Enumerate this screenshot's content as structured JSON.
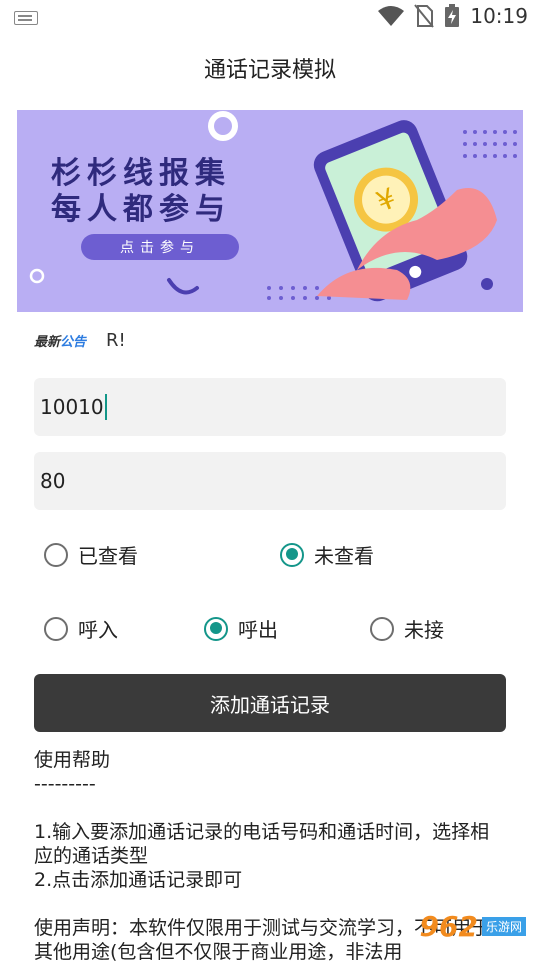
{
  "status_bar": {
    "time": "10:19"
  },
  "header": {
    "title": "通话记录模拟"
  },
  "banner": {
    "line1": "杉杉线报集",
    "line2": "每人都参与",
    "button_label": "点击参与"
  },
  "notice": {
    "logo_a": "最新",
    "logo_b": "公告",
    "message": "R!"
  },
  "form": {
    "phone_value": "10010",
    "duration_value": "80"
  },
  "status_options": [
    {
      "label": "已查看",
      "checked": false
    },
    {
      "label": "未查看",
      "checked": true
    }
  ],
  "type_options": [
    {
      "label": "呼入",
      "checked": false
    },
    {
      "label": "呼出",
      "checked": true
    },
    {
      "label": "未接",
      "checked": false
    }
  ],
  "add_button_label": "添加通话记录",
  "help": {
    "title": "使用帮助",
    "divider": "---------",
    "step1": "1.输入要添加通话记录的电话号码和通话时间，选择相应的通话类型",
    "step2": "2.点击添加通话记录即可",
    "disclaimer": "使用声明：本软件仅限用于测试与交流学习，不可用于其他用途(包含但不仅限于商业用途，非法用"
  },
  "watermark": {
    "number": "962",
    "site": "乐游网"
  },
  "colors": {
    "accent": "#14968a",
    "banner_bg": "#b9aef3",
    "button_bg": "#3a3a3a"
  }
}
